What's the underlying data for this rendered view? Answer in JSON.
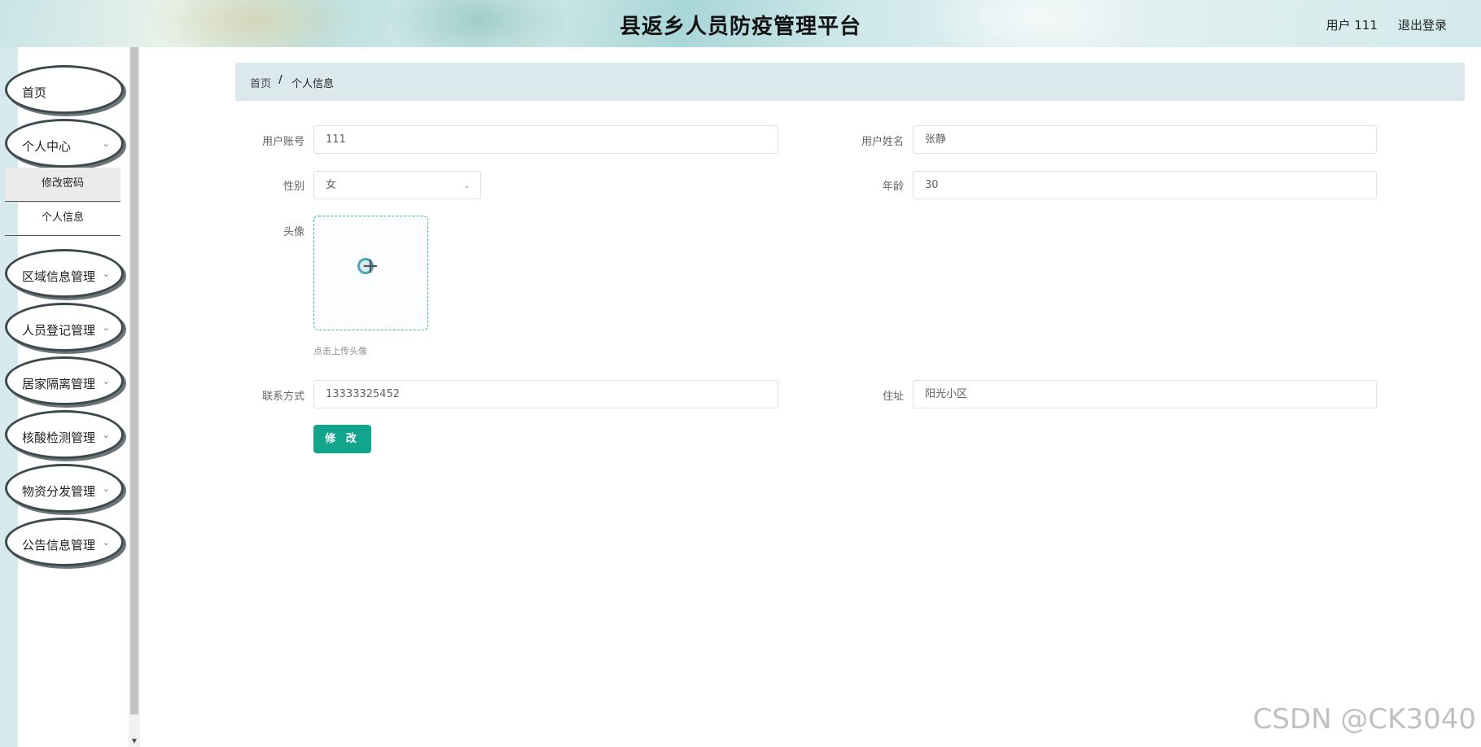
{
  "header": {
    "title": "县返乡人员防疫管理平台",
    "user": "用户 111",
    "logout": "退出登录"
  },
  "sidebar": {
    "items": [
      {
        "label": "首页",
        "has_arrow": false
      },
      {
        "label": "个人中心",
        "has_arrow": true,
        "children": [
          {
            "label": "修改密码"
          },
          {
            "label": "个人信息"
          }
        ]
      },
      {
        "label": "区域信息管理",
        "has_arrow": true
      },
      {
        "label": "人员登记管理",
        "has_arrow": true
      },
      {
        "label": "居家隔离管理",
        "has_arrow": true
      },
      {
        "label": "核酸检测管理",
        "has_arrow": true
      },
      {
        "label": "物资分发管理",
        "has_arrow": true
      },
      {
        "label": "公告信息管理",
        "has_arrow": true
      }
    ],
    "arrow_icon": "chevron-down-icon"
  },
  "breadcrumb": {
    "home": "首页",
    "separator": "/",
    "current": "个人信息"
  },
  "form": {
    "account_label": "用户账号",
    "account_value": "111",
    "name_label": "用户姓名",
    "name_value": "张静",
    "gender_label": "性别",
    "gender_value": "女",
    "age_label": "年龄",
    "age_value": "30",
    "avatar_label": "头像",
    "avatar_tip": "点击上传头像",
    "phone_label": "联系方式",
    "phone_value": "13333325452",
    "address_label": "住址",
    "address_value": "阳光小区",
    "submit_label": "修 改"
  },
  "colors": {
    "accent": "#13a58c",
    "breadcrumb_bg": "#dbe9ec",
    "sidebar_strip": "#d6e9ec"
  },
  "watermark": "CSDN @CK3040"
}
